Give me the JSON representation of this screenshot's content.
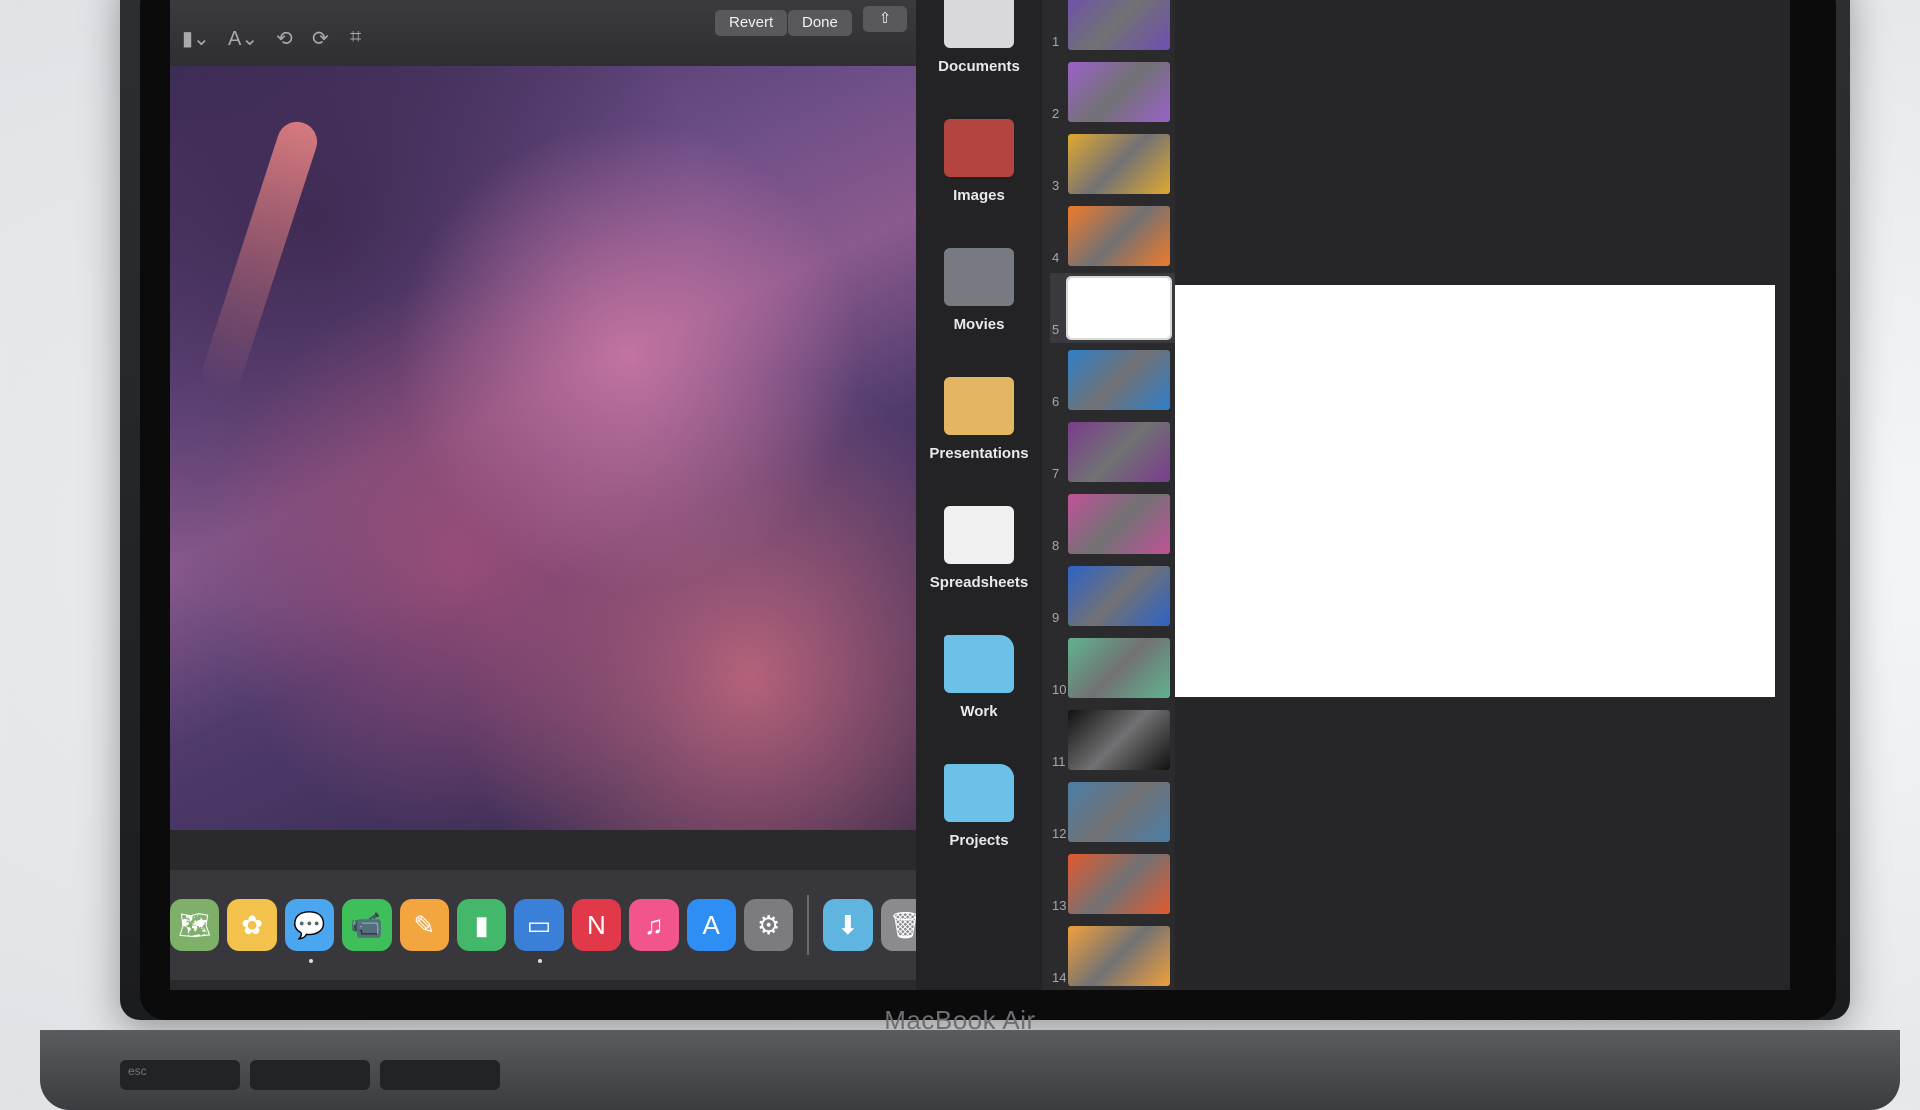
{
  "markup": {
    "revert_label": "Revert",
    "done_label": "Done",
    "share_icon": "⇧"
  },
  "files": [
    {
      "label": "Documents",
      "icon": "documents-icon",
      "color": "#d9d9db"
    },
    {
      "label": "Images",
      "icon": "images-icon",
      "color": "#b4443f"
    },
    {
      "label": "Movies",
      "icon": "movies-icon",
      "color": "#777a80"
    },
    {
      "label": "Presentations",
      "icon": "presentations-icon",
      "color": "#e4b662"
    },
    {
      "label": "Spreadsheets",
      "icon": "spreadsheets-icon",
      "color": "#f0f0f0"
    },
    {
      "label": "Work",
      "icon": "folder-icon",
      "color": "#6cc1e8"
    },
    {
      "label": "Projects",
      "icon": "folder-icon",
      "color": "#6cc1e8"
    }
  ],
  "slides": [
    {
      "num": "1",
      "color": "#6e4fb0"
    },
    {
      "num": "2",
      "color": "#9a62c8"
    },
    {
      "num": "3",
      "color": "#e0a832"
    },
    {
      "num": "4",
      "color": "#ef7a2a"
    },
    {
      "num": "5",
      "color": "#ffffff"
    },
    {
      "num": "6",
      "color": "#2f7fc9"
    },
    {
      "num": "7",
      "color": "#7a3c8e"
    },
    {
      "num": "8",
      "color": "#c05298"
    },
    {
      "num": "9",
      "color": "#2d63c7"
    },
    {
      "num": "10",
      "color": "#5fb38f"
    },
    {
      "num": "11",
      "color": "#111111"
    },
    {
      "num": "12",
      "color": "#4b7ea8"
    },
    {
      "num": "13",
      "color": "#e05a2f"
    },
    {
      "num": "14",
      "color": "#f0a03a"
    }
  ],
  "dock": [
    {
      "name": "maps-icon",
      "glyph": "🗺",
      "color": "#7fb06a"
    },
    {
      "name": "photos-icon",
      "glyph": "✿",
      "color": "#f3c24c"
    },
    {
      "name": "messages-icon",
      "glyph": "💬",
      "color": "#4aa7ef"
    },
    {
      "name": "facetime-icon",
      "glyph": "📹",
      "color": "#3fbf5a"
    },
    {
      "name": "pages-icon",
      "glyph": "✎",
      "color": "#f3a640"
    },
    {
      "name": "numbers-icon",
      "glyph": "▮",
      "color": "#44b86a"
    },
    {
      "name": "keynote-icon",
      "glyph": "▭",
      "color": "#3a7fd8"
    },
    {
      "name": "news-icon",
      "glyph": "N",
      "color": "#e2394a"
    },
    {
      "name": "music-icon",
      "glyph": "♫",
      "color": "#f2548d"
    },
    {
      "name": "app-store-icon",
      "glyph": "A",
      "color": "#2f8ef4"
    },
    {
      "name": "system-preferences-icon",
      "glyph": "⚙",
      "color": "#7b7b80"
    }
  ],
  "dock_extras": [
    {
      "name": "downloads-folder-icon",
      "glyph": "⬇",
      "color": "#5fb4e0"
    },
    {
      "name": "trash-icon",
      "glyph": "🗑",
      "color": "#8a8a8f"
    }
  ],
  "device": {
    "brand": "MacBook Air",
    "key_labels": [
      "esc"
    ]
  }
}
